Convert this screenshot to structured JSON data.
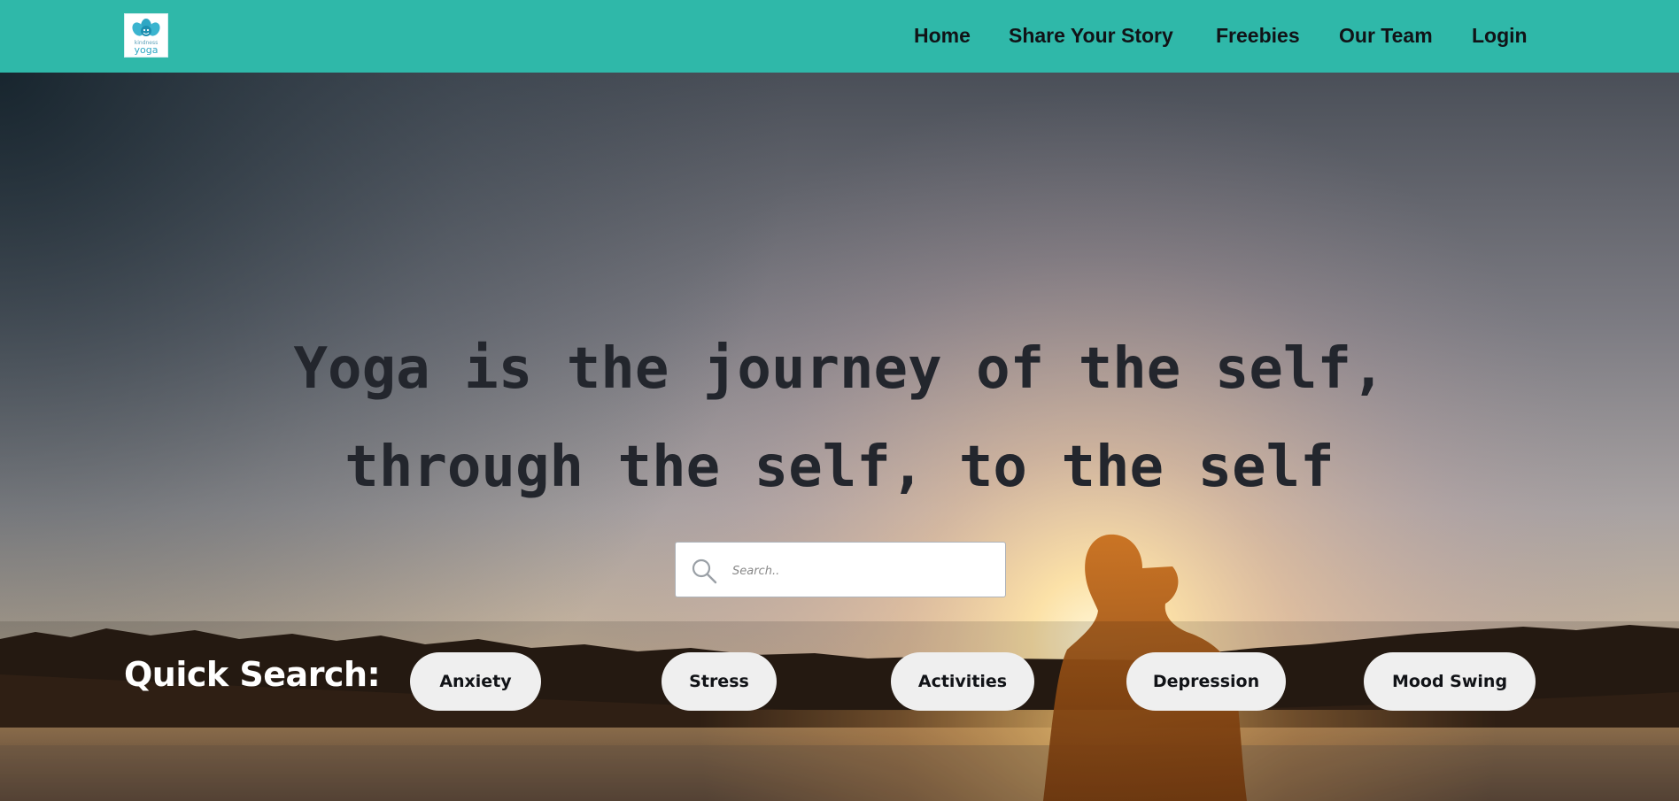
{
  "brand": {
    "logo_text_top": "kindness",
    "logo_text_bottom": "yoga",
    "logo_color": "#2fa7c4"
  },
  "nav": {
    "background": "#2fb8a9",
    "items": [
      {
        "label": "Home"
      },
      {
        "label": "Share Your Story"
      },
      {
        "label": "Freebies"
      },
      {
        "label": "Our Team"
      },
      {
        "label": "Login"
      }
    ]
  },
  "hero": {
    "quote_line1": "Yoga is the journey of the self,",
    "quote_line2": "through the self, to the self",
    "search_placeholder": "Search..",
    "quick_search_label": "Quick Search:",
    "quick_search_tags": [
      {
        "label": "Anxiety"
      },
      {
        "label": "Stress"
      },
      {
        "label": "Activities"
      },
      {
        "label": "Depression"
      },
      {
        "label": "Mood Swing"
      }
    ],
    "icons": {
      "search": "search-icon"
    }
  }
}
